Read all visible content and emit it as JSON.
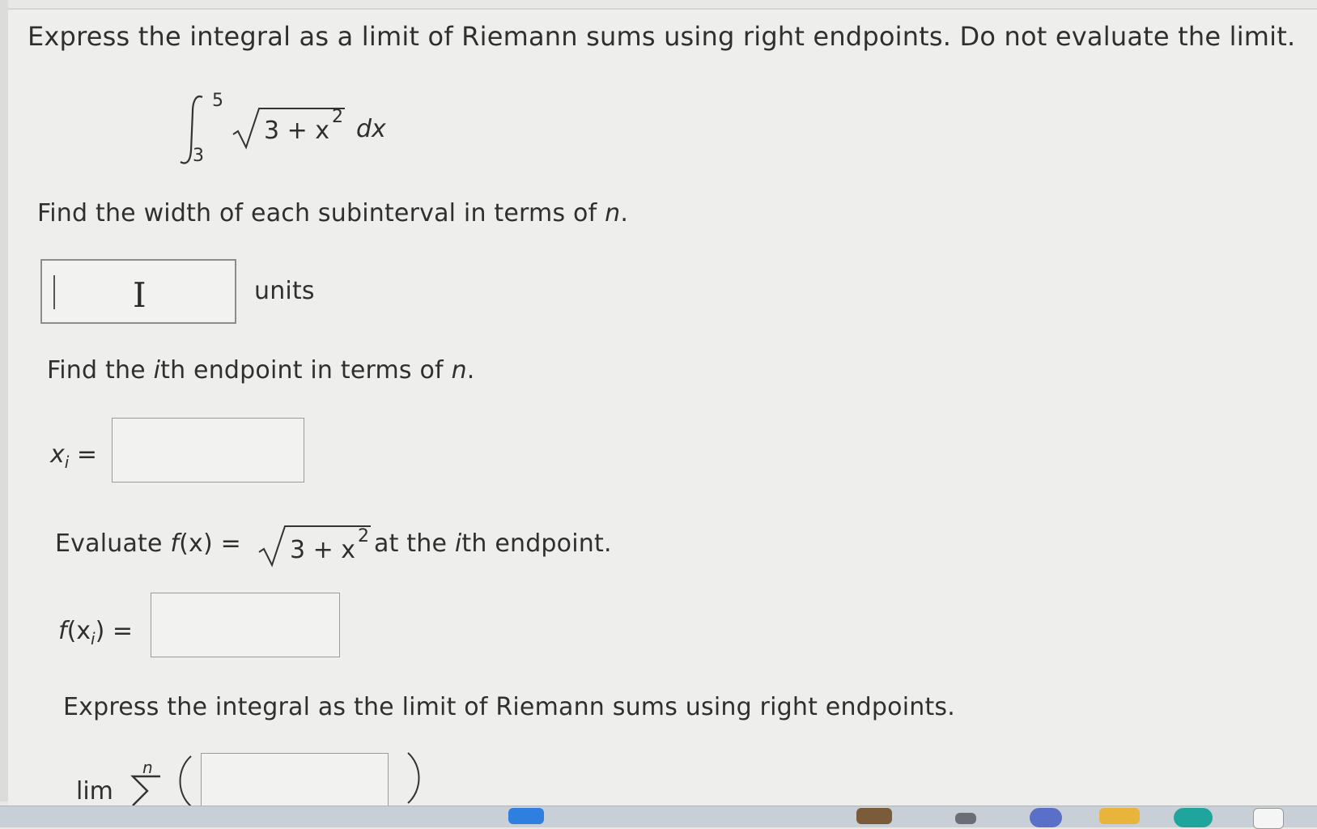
{
  "question": {
    "intro": "Express the integral as a limit of Riemann sums using right endpoints. Do not evaluate the limit.",
    "integral": {
      "upper": "5",
      "lower": "3",
      "radicand": "3 + x",
      "exponent": "2",
      "differential": "dx"
    }
  },
  "part_width": {
    "prompt_prefix": "Find the width of each subinterval in terms of ",
    "prompt_var": "n",
    "prompt_suffix": ".",
    "answer_value": "",
    "unit_label": "units"
  },
  "part_endpoint": {
    "prompt_a": "Find the ",
    "prompt_i": "i",
    "prompt_b": "th endpoint in terms of ",
    "prompt_var": "n",
    "prompt_suffix": ".",
    "label_x": "x",
    "label_sub": "i",
    "label_eq": "=",
    "answer_value": ""
  },
  "part_eval": {
    "prompt_a": "Evaluate ",
    "func": "f",
    "func_arg": "(x)",
    "equals": "=",
    "radicand": "3 + x",
    "exponent": "2",
    "prompt_b": " at the ",
    "prompt_i": "i",
    "prompt_c": "th endpoint.",
    "label_f": "f",
    "label_open": "(x",
    "label_sub": "i",
    "label_close": ")",
    "label_eq": "=",
    "answer_value": ""
  },
  "part_limit": {
    "prompt": "Express the integral as the limit of Riemann sums using right endpoints.",
    "lim_label": "lim",
    "sum_upper": "n",
    "answer_value": ""
  }
}
